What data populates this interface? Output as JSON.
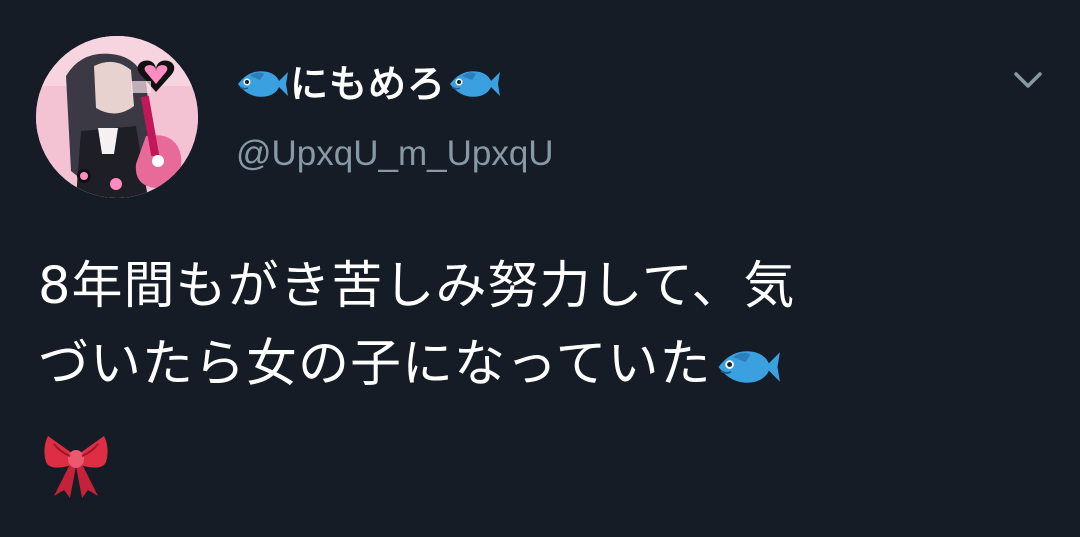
{
  "tweet": {
    "display_name": "にもめろ",
    "handle": "@UpxqU_m_UpxqU",
    "text_line1": "8年間もがき苦しみ努力して、気",
    "text_line2": "づいたら女の子になっていた",
    "name_icon_before": "fish-emoji",
    "name_icon_after": "fish-emoji",
    "text_trailing_icon": "fish-emoji",
    "text_final_icon": "ribbon-emoji",
    "menu_icon": "chevron-down-icon"
  },
  "colors": {
    "background": "#151c25",
    "text": "#ffffff",
    "secondary_text": "#8899a6",
    "fish": "#3aa0e0",
    "ribbon": "#dd2e44"
  }
}
